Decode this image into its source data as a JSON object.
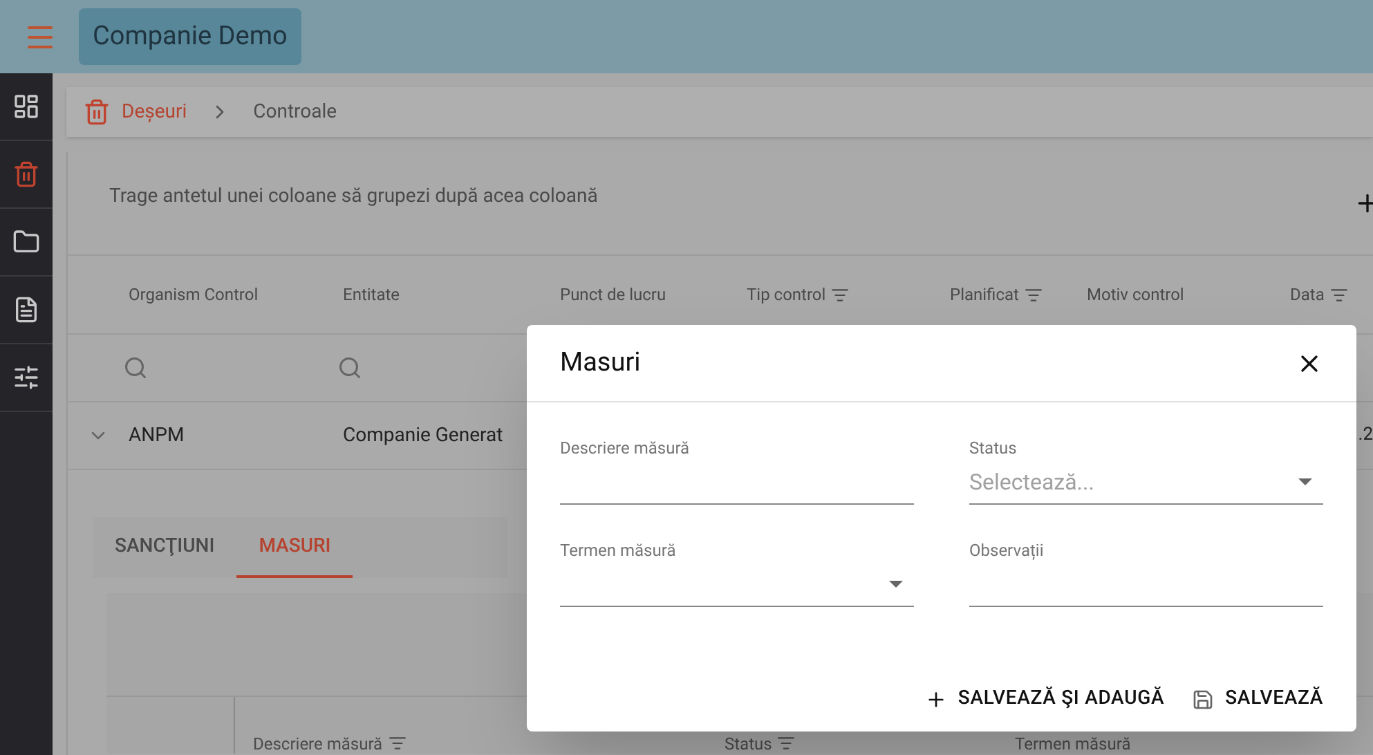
{
  "app_bar": {
    "title": "Companie Demo"
  },
  "sidebar": {
    "items": [
      {
        "kind": "dashboard",
        "selected": false
      },
      {
        "kind": "trash",
        "selected": true
      },
      {
        "kind": "folder",
        "selected": false
      },
      {
        "kind": "document",
        "selected": false
      },
      {
        "kind": "sliders",
        "selected": false
      }
    ]
  },
  "breadcrumb": [
    {
      "label": "Deșeuri"
    },
    {
      "label": "Controale"
    }
  ],
  "grid": {
    "group_hint": "Trage antetul unei coloane să grupezi după acea coloană",
    "columns": [
      {
        "label": "Organism Control",
        "filter": false,
        "searchable": true
      },
      {
        "label": "Entitate",
        "filter": false,
        "searchable": true
      },
      {
        "label": "Punct de lucru",
        "filter": false
      },
      {
        "label": "Tip control",
        "filter": true
      },
      {
        "label": "Planificat",
        "filter": true
      },
      {
        "label": "Motiv control",
        "filter": false
      },
      {
        "label": "Data",
        "filter": true
      }
    ],
    "rows": [
      {
        "expanded": true,
        "cells": [
          "ANPM",
          "Companie Generat"
        ],
        "trailing": ".2"
      }
    ]
  },
  "detail_tabs": [
    {
      "label": "SANCŢIUNI",
      "selected": false
    },
    {
      "label": "MASURI",
      "selected": true
    }
  ],
  "detail_table": {
    "columns": [
      {
        "label": "Descriere măsură",
        "filter": true
      },
      {
        "label": "Status",
        "filter": true
      },
      {
        "label": "Termen măsură",
        "filter": false
      }
    ]
  },
  "dialog": {
    "title": "Masuri",
    "fields": [
      {
        "label": "Descriere măsură",
        "kind": "text"
      },
      {
        "label": "Status",
        "kind": "select",
        "placeholder": "Selectează..."
      },
      {
        "label": "Termen măsură",
        "kind": "select"
      },
      {
        "label": "Observații",
        "kind": "text"
      }
    ],
    "actions": [
      {
        "label": "SALVEAZĂ ŞI ADAUGĂ",
        "kind": "plus"
      },
      {
        "label": "SALVEAZĂ",
        "kind": "save"
      }
    ]
  }
}
